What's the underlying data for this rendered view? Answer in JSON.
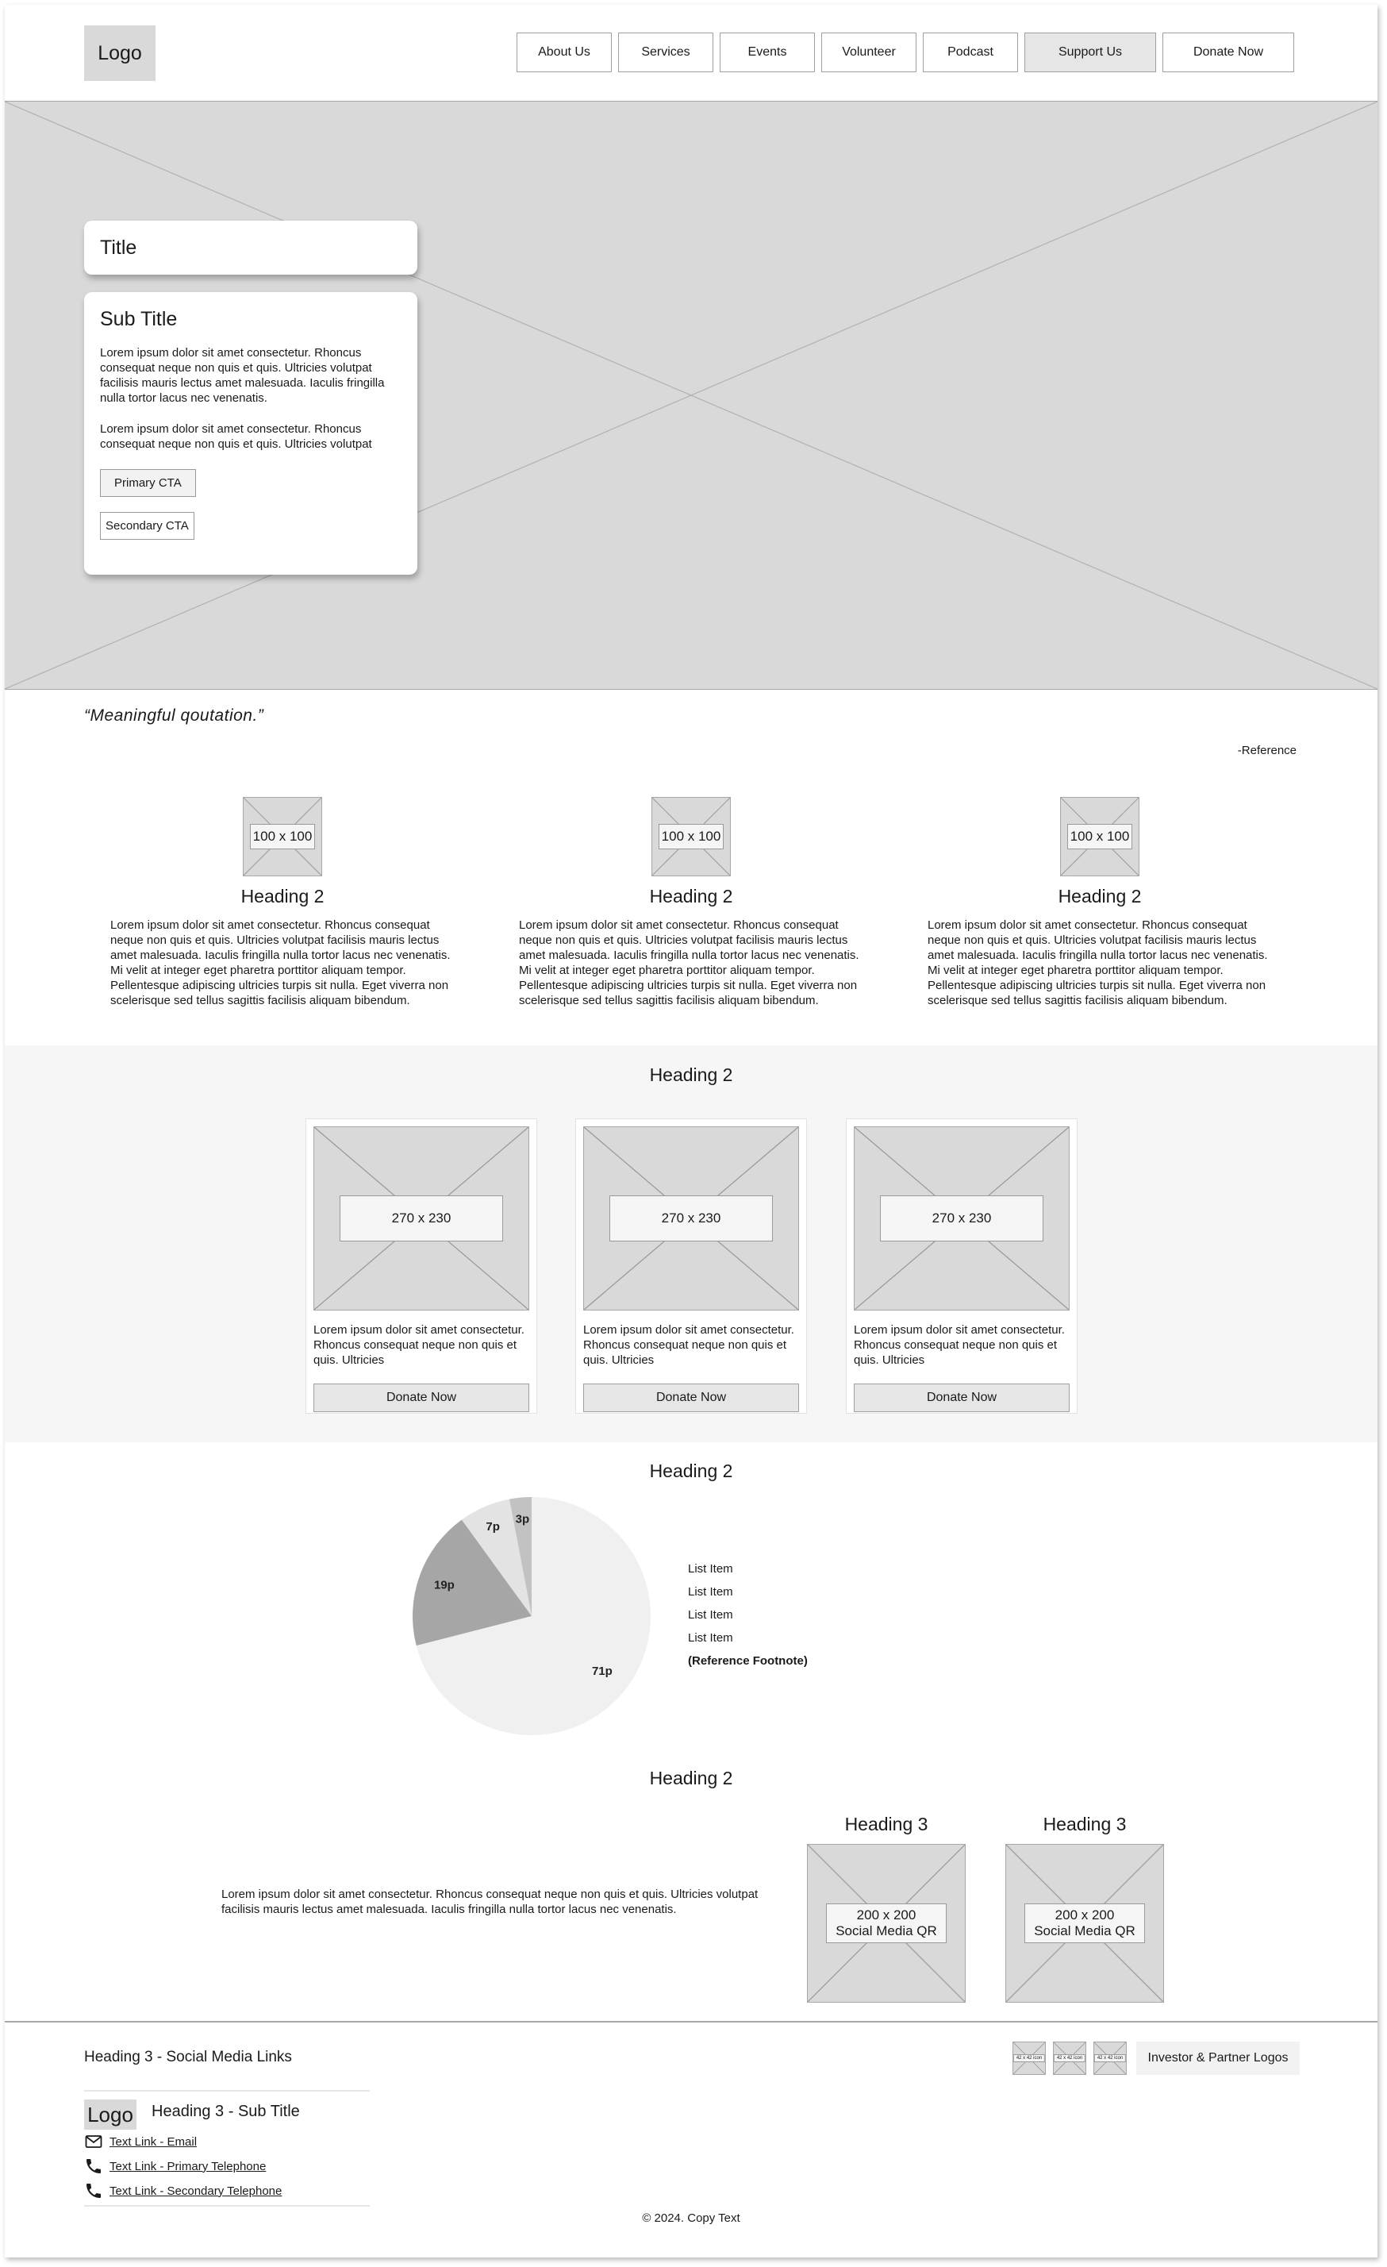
{
  "header": {
    "logo": "Logo",
    "nav": [
      "About Us",
      "Services",
      "Events",
      "Volunteer",
      "Podcast",
      "Support Us",
      "Donate Now"
    ],
    "active_nav": "Support Us"
  },
  "hero": {
    "title": "Title",
    "subtitle": "Sub Title",
    "paragraph1": "Lorem ipsum dolor sit amet consectetur. Rhoncus consequat neque non quis et quis. Ultricies volutpat facilisis mauris lectus amet malesuada. Iaculis fringilla nulla tortor lacus nec venenatis.",
    "paragraph2": "Lorem ipsum dolor sit amet consectetur. Rhoncus consequat neque non quis et quis. Ultricies volutpat",
    "primary_cta": "Primary CTA",
    "secondary_cta": "Secondary CTA"
  },
  "quote": {
    "text": "“Meaningful qoutation.”",
    "reference": "-Reference"
  },
  "features": [
    {
      "image_label": "100 x 100",
      "heading": "Heading 2",
      "body": "Lorem ipsum dolor sit amet consectetur. Rhoncus consequat neque non quis et quis. Ultricies volutpat facilisis mauris lectus amet malesuada. Iaculis fringilla nulla tortor lacus nec venenatis. Mi velit at integer eget pharetra porttitor aliquam tempor. Pellentesque adipiscing ultricies turpis sit nulla. Eget viverra non scelerisque sed tellus sagittis facilisis aliquam bibendum."
    },
    {
      "image_label": "100 x 100",
      "heading": "Heading 2",
      "body": "Lorem ipsum dolor sit amet consectetur. Rhoncus consequat neque non quis et quis. Ultricies volutpat facilisis mauris lectus amet malesuada. Iaculis fringilla nulla tortor lacus nec venenatis. Mi velit at integer eget pharetra porttitor aliquam tempor. Pellentesque adipiscing ultricies turpis sit nulla. Eget viverra non scelerisque sed tellus sagittis facilisis aliquam bibendum."
    },
    {
      "image_label": "100 x 100",
      "heading": "Heading 2",
      "body": "Lorem ipsum dolor sit amet consectetur. Rhoncus consequat neque non quis et quis. Ultricies volutpat facilisis mauris lectus amet malesuada. Iaculis fringilla nulla tortor lacus nec venenatis. Mi velit at integer eget pharetra porttitor aliquam tempor. Pellentesque adipiscing ultricies turpis sit nulla. Eget viverra non scelerisque sed tellus sagittis facilisis aliquam bibendum."
    }
  ],
  "donations": {
    "heading": "Heading 2",
    "cards": [
      {
        "image_label": "270 x 230",
        "text": "Lorem ipsum dolor sit amet consectetur. Rhoncus consequat neque non quis et quis. Ultricies",
        "button": "Donate Now"
      },
      {
        "image_label": "270 x 230",
        "text": "Lorem ipsum dolor sit amet consectetur. Rhoncus consequat neque non quis et quis. Ultricies",
        "button": "Donate Now"
      },
      {
        "image_label": "270 x 230",
        "text": "Lorem ipsum dolor sit amet consectetur. Rhoncus consequat neque non quis et quis. Ultricies",
        "button": "Donate Now"
      }
    ]
  },
  "chart_section": {
    "heading": "Heading 2",
    "list": [
      "List Item",
      "List Item",
      "List Item",
      "List Item"
    ],
    "footnote": "(Reference Footnote)"
  },
  "chart_data": {
    "type": "pie",
    "slices": [
      {
        "label": "3p",
        "value": 3,
        "color": "#c2c2c2"
      },
      {
        "label": "7p",
        "value": 7,
        "color": "#e3e3e3"
      },
      {
        "label": "19p",
        "value": 19,
        "color": "#a6a6a6"
      },
      {
        "label": "71p",
        "value": 71,
        "color": "#f0f0f0"
      }
    ]
  },
  "qr_section": {
    "heading": "Heading 2",
    "text": "Lorem ipsum dolor sit amet consectetur. Rhoncus consequat neque non quis et quis. Ultricies volutpat facilisis mauris lectus amet malesuada. Iaculis fringilla nulla tortor lacus nec venenatis.",
    "qrs": [
      {
        "heading": "Heading 3",
        "label_line1": "200 x 200",
        "label_line2": "Social Media QR"
      },
      {
        "heading": "Heading 3",
        "label_line1": "200 x 200",
        "label_line2": "Social Media QR"
      }
    ]
  },
  "footer": {
    "social_heading": "Heading 3 - Social Media Links",
    "partner_icon_label": "42 x 42 icon",
    "partner_label": "Investor & Partner Logos",
    "logo": "Logo",
    "subtitle": "Heading 3 - Sub Title",
    "email_link": "Text Link - Email",
    "primary_phone_link": "Text Link - Primary Telephone",
    "secondary_phone_link": "Text Link - Secondary Telephone",
    "copyright": "© 2024. Copy Text"
  }
}
